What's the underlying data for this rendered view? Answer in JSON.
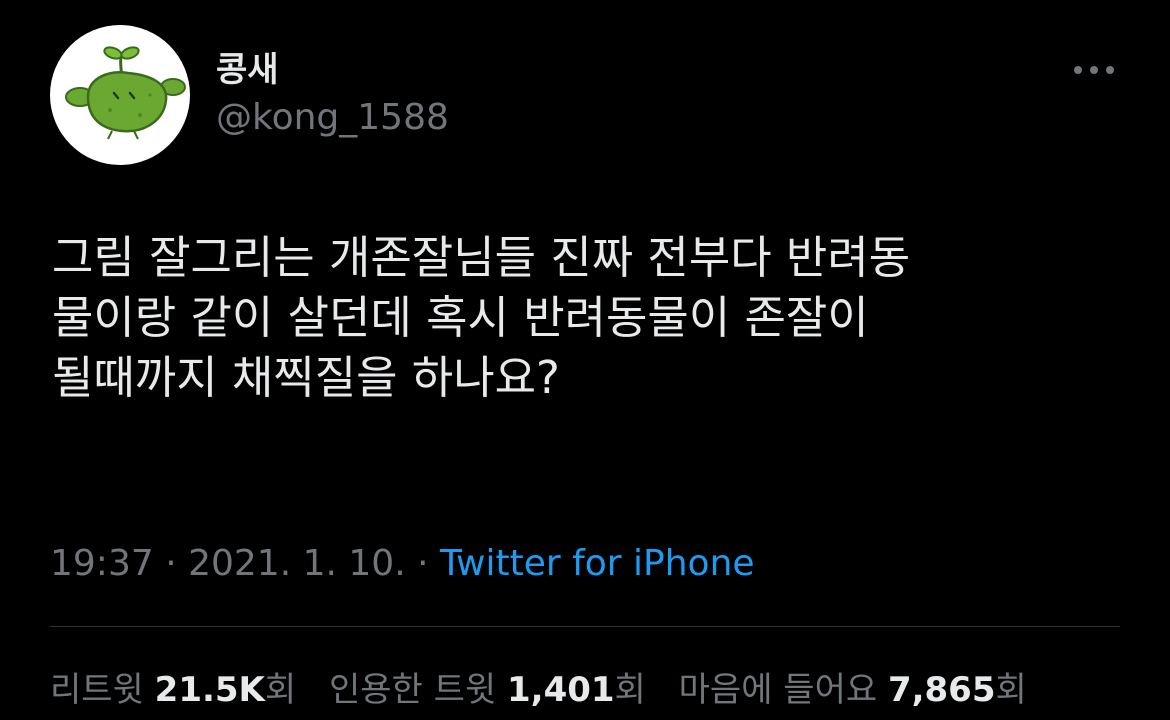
{
  "user": {
    "display_name": "콩새",
    "handle": "@kong_1588",
    "avatar_icon": "green-sprout-bean-avatar"
  },
  "more_icon": "more-dots-icon",
  "tweet": {
    "lines": [
      "그림 잘그리는 개존잘님들 진짜 전부다 반려동",
      "물이랑 같이 살던데 혹시 반려동물이 존잘이",
      "될때까지 채찍질을 하나요?"
    ]
  },
  "meta": {
    "time": "19:37",
    "sep1": " · ",
    "date": "2021. 1. 10.",
    "sep2": " · ",
    "source": "Twitter for iPhone"
  },
  "stats": {
    "retweets_label": "리트윗 ",
    "retweets": "21.5K",
    "retweets_suffix": "회",
    "quotes_label": "인용한 트윗 ",
    "quotes": "1,401",
    "quotes_suffix": "회",
    "likes_label": "마음에 들어요 ",
    "likes": "7,865",
    "likes_suffix": "회"
  },
  "colors": {
    "background": "#000000",
    "text": "#e7e9ea",
    "secondary": "#71767b",
    "link": "#1d9bf0",
    "avatar_green": "#6ba832"
  }
}
